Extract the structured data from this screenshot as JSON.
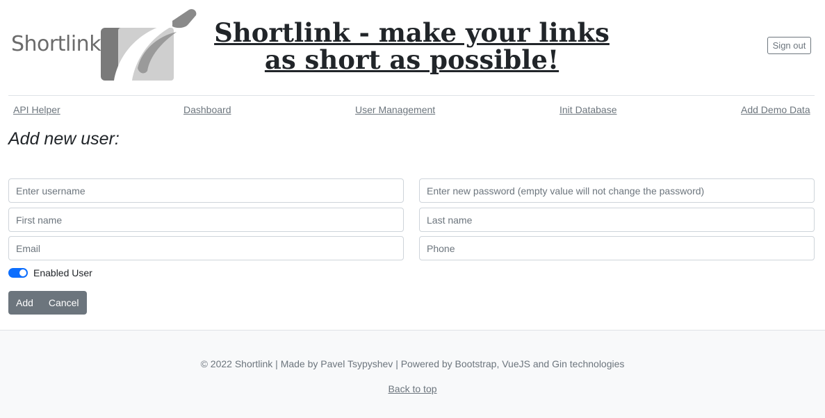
{
  "header": {
    "logo_text": "Shortlink",
    "title": "Shortlink - make your links as short as possible!",
    "sign_out_label": "Sign out"
  },
  "nav": {
    "items": [
      {
        "label": "API Helper"
      },
      {
        "label": "Dashboard"
      },
      {
        "label": "User Management"
      },
      {
        "label": "Init Database"
      },
      {
        "label": "Add Demo Data"
      }
    ]
  },
  "form": {
    "heading": "Add new user:",
    "username": {
      "placeholder": "Enter username",
      "value": ""
    },
    "password": {
      "placeholder": "Enter new password (empty value will not change the password)",
      "value": ""
    },
    "first_name": {
      "placeholder": "First name",
      "value": ""
    },
    "last_name": {
      "placeholder": "Last name",
      "value": ""
    },
    "email": {
      "placeholder": "Email",
      "value": ""
    },
    "phone": {
      "placeholder": "Phone",
      "value": ""
    },
    "enabled_label": "Enabled User",
    "enabled": true,
    "add_label": "Add",
    "cancel_label": "Cancel"
  },
  "footer": {
    "text": "© 2022 Shortlink | Made by Pavel Tsypyshev | Powered by Bootstrap, VueJS and Gin technologies",
    "back_to_top": "Back to top"
  },
  "colors": {
    "primary": "#0d6efd",
    "secondary": "#6c757d",
    "footer_bg": "#f8f9fa"
  }
}
